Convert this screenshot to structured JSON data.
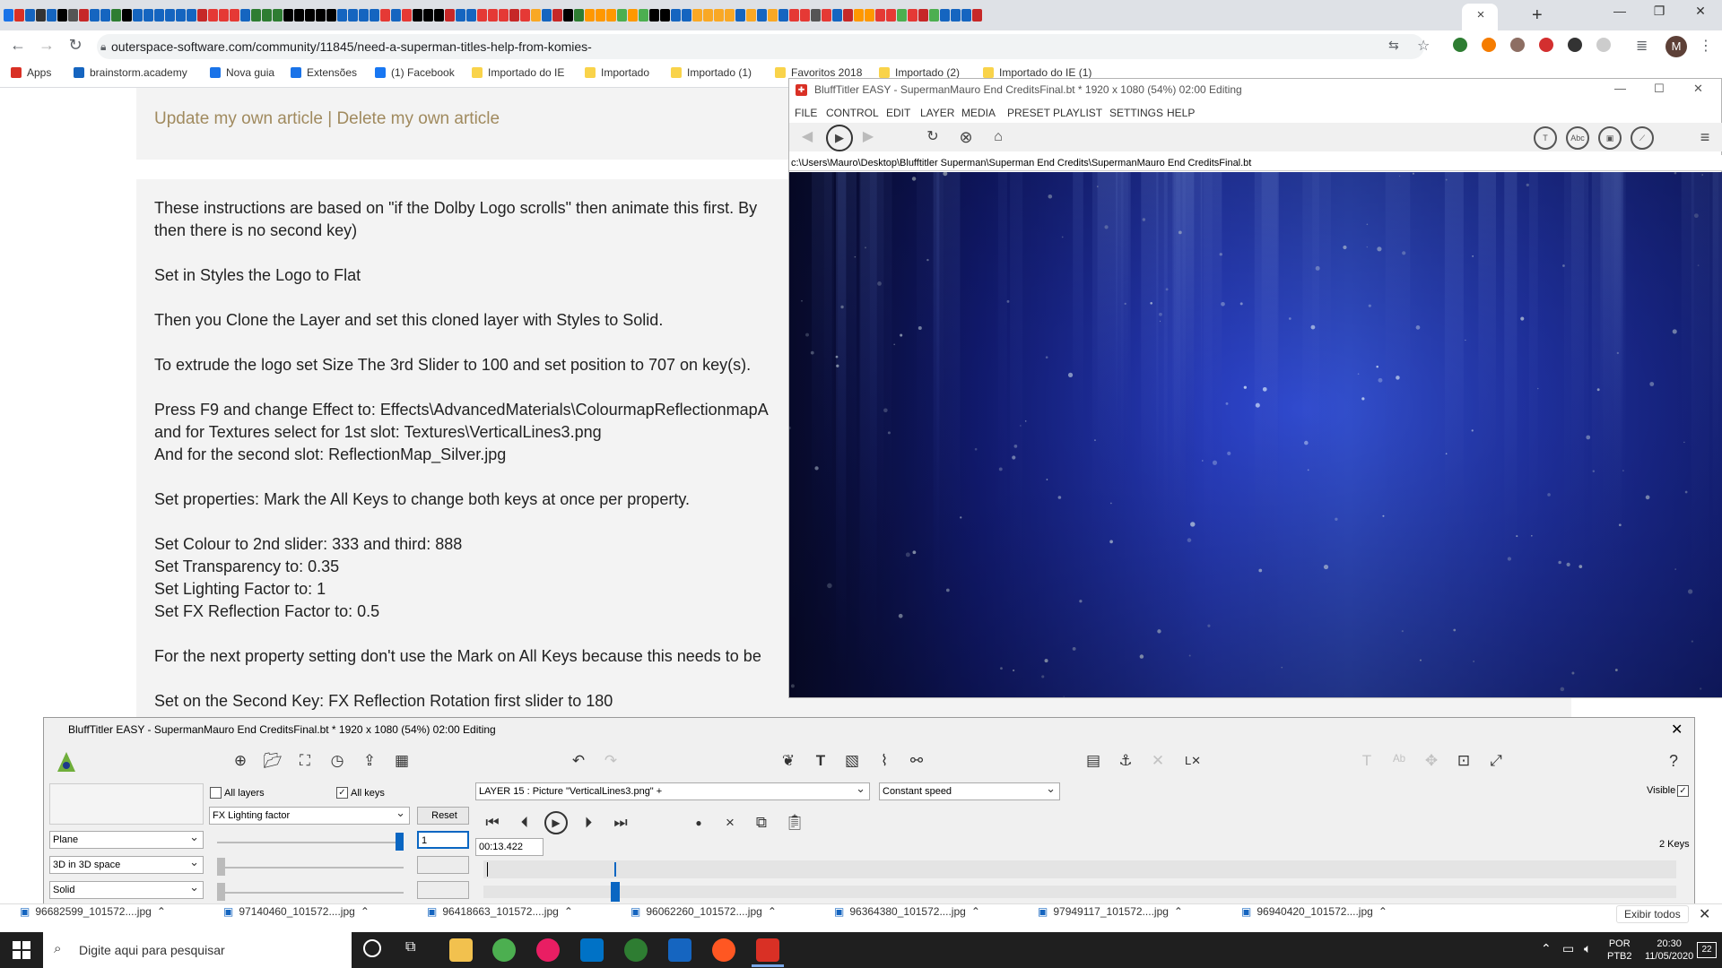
{
  "browser": {
    "tab_close": "×",
    "new_tab": "+",
    "window_controls": [
      "—",
      "❐",
      "✕"
    ],
    "url": "outerspace-software.com/community/11845/need-a-superman-titles-help-from-komies-",
    "bookmarks": [
      "Apps",
      "brainstorm.academy",
      "Nova guia",
      "Extensões",
      "(1) Facebook",
      "Importado do IE",
      "Importado",
      "Importado (1)",
      "Favoritos 2018",
      "Importado (2)",
      "Importado do IE (1)"
    ],
    "avatar_letter": "M",
    "tab_favicon_colors": [
      "#1a73e8",
      "#d93025",
      "#1565c0",
      "#333",
      "#1565c0",
      "#000",
      "#555",
      "#c62828",
      "#1565c0",
      "#1565c0",
      "#2e7d32",
      "#000",
      "#1565c0",
      "#1565c0",
      "#1565c0",
      "#1565c0",
      "#1565c0",
      "#1565c0",
      "#c62828",
      "#e53935",
      "#e53935",
      "#e53935",
      "#1565c0",
      "#2e7d32",
      "#2e7d32",
      "#2e7d32",
      "#000",
      "#000",
      "#000",
      "#000",
      "#000",
      "#1565c0",
      "#1565c0",
      "#1565c0",
      "#1565c0",
      "#e53935",
      "#1565c0",
      "#e53935",
      "#000",
      "#000",
      "#000",
      "#c62828",
      "#1565c0",
      "#1565c0",
      "#e53935",
      "#e53935",
      "#e53935",
      "#c62828",
      "#e53935",
      "#f9a825",
      "#1565c0",
      "#c62828",
      "#000",
      "#2e7d32",
      "#ff9800",
      "#ff9800",
      "#ff9800",
      "#4caf50",
      "#ff9800",
      "#4caf50",
      "#000",
      "#000",
      "#1565c0",
      "#1565c0",
      "#f9a825",
      "#f9a825",
      "#f9a825",
      "#f9a825",
      "#1565c0",
      "#f9a825",
      "#1565c0",
      "#f9a825",
      "#1565c0",
      "#e53935",
      "#e53935",
      "#555",
      "#e53935",
      "#1565c0",
      "#c62828",
      "#ff9800",
      "#ff9800",
      "#e53935",
      "#e53935",
      "#4caf50",
      "#e53935",
      "#c62828",
      "#4caf50",
      "#1565c0",
      "#1565c0",
      "#1565c0",
      "#c62828"
    ]
  },
  "article": {
    "top_links": "Update my own article | Delete my own article",
    "lines": [
      "These instructions are based on \"if the Dolby Logo scrolls\" then animate this first. By",
      "then there is no second key)",
      "Set in Styles the Logo to Flat",
      "Then you Clone the Layer and set this cloned layer with Styles to Solid.",
      "To extrude the logo set Size The 3rd Slider to 100 and set position to 707 on key(s).",
      "Press F9 and change Effect to: Effects\\AdvancedMaterials\\ColourmapReflectionmapA",
      "and for Textures select for 1st slot: Textures\\VerticalLines3.png",
      "And for the second slot: ReflectionMap_Silver.jpg",
      "Set properties: Mark the All Keys to change both keys at once per property.",
      "Set Colour to 2nd slider: 333 and third: 888",
      "Set Transparency to: 0.35",
      "Set Lighting Factor to: 1",
      "Set FX Reflection Factor to: 0.5",
      "For the next property setting don't use the Mark on All Keys because this needs to be",
      "Set on the Second Key: FX Reflection Rotation first slider to 180"
    ]
  },
  "player": {
    "title": "BluffTitler EASY  - SupermanMauro End CreditsFinal.bt * 1920 x 1080 (54%) 02:00 Editing",
    "menu": [
      "FILE",
      "CONTROL",
      "EDIT",
      "LAYER",
      "MEDIA",
      "PRESET",
      "PLAYLIST",
      "SETTINGS",
      "HELP"
    ],
    "path": "c:\\Users\\Mauro\\Desktop\\Blufftitler Superman\\Superman End Credits\\SupermanMauro End CreditsFinal.bt",
    "tool_labels": [
      "T",
      "Abc",
      "",
      ""
    ],
    "menu_icon": "≡"
  },
  "editor": {
    "title": "BluffTitler EASY  - SupermanMauro End CreditsFinal.bt * 1920 x 1080 (54%) 02:00 Editing",
    "all_layers_label": "All layers",
    "all_keys_label": "All keys",
    "property_select": "FX Lighting factor",
    "reset_label": "Reset",
    "layer_select": "LAYER 15    : Picture \"VerticalLines3.png\" +",
    "speed_select": "Constant speed",
    "visible_label": "Visible",
    "keys_count": "2 Keys",
    "value_input": "1",
    "time_input": "00:13.422",
    "slider_value": 1.0,
    "timeline_position": 0.11,
    "plane_select": "Plane",
    "space_select": "3D in 3D space",
    "style_select": "Solid",
    "all_layers_checked": false,
    "all_keys_checked": true,
    "visible_checked": true
  },
  "downloads": {
    "files": [
      "96682599_101572....jpg",
      "97140460_101572....jpg",
      "96418663_101572....jpg",
      "96062260_101572....jpg",
      "96364380_101572....jpg",
      "97949117_101572....jpg",
      "96940420_101572....jpg"
    ],
    "show_all": "Exibir todos"
  },
  "taskbar": {
    "search_placeholder": "Digite aqui para pesquisar",
    "lang": "POR",
    "layout": "PTB2",
    "time": "20:30",
    "date": "11/05/2020",
    "notif": "22"
  }
}
